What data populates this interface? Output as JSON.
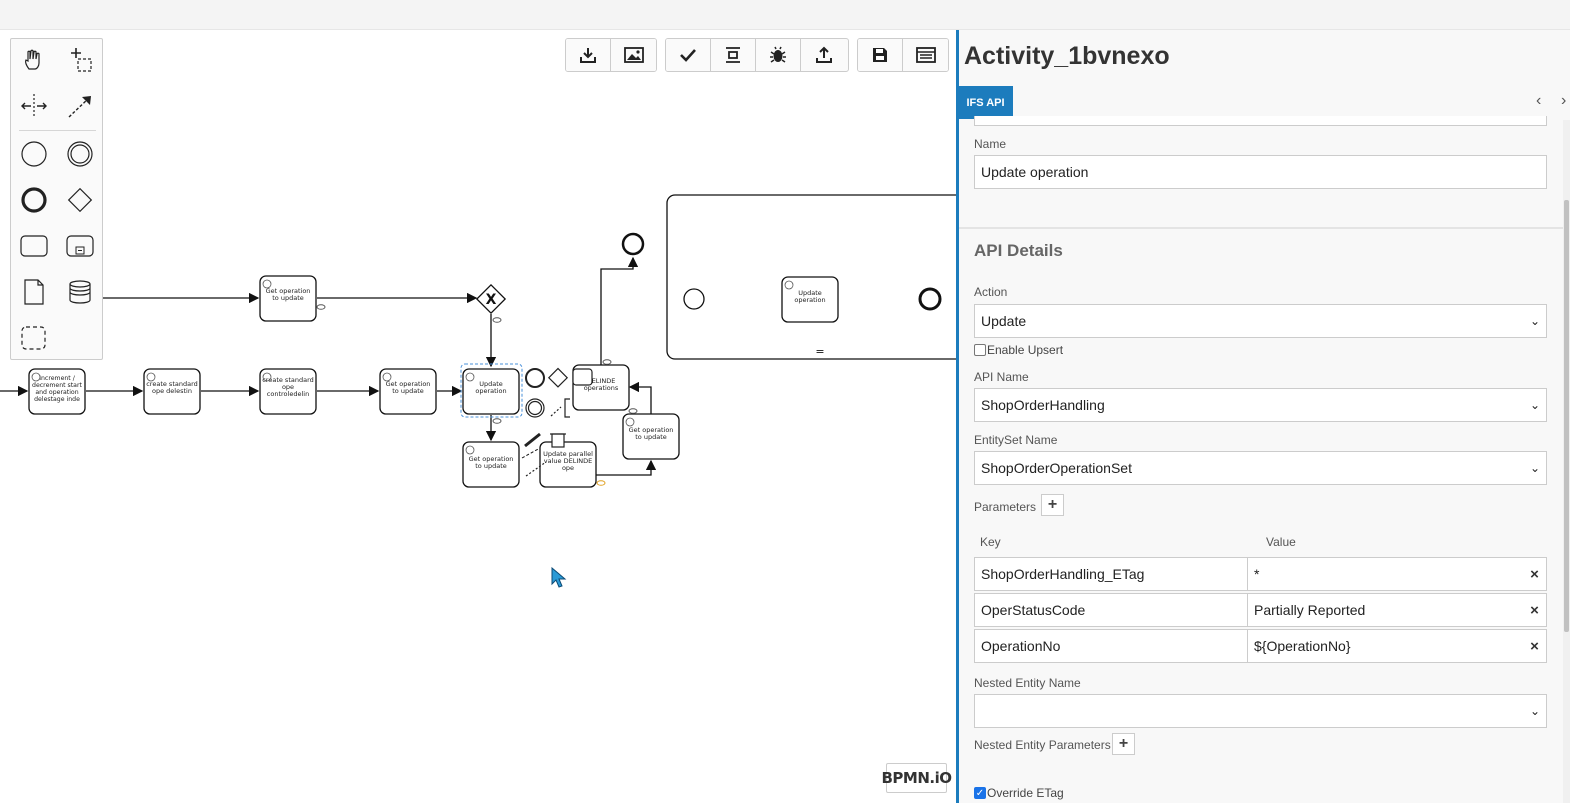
{
  "toolbar": {
    "groups": [
      [
        "download-icon",
        "image-icon"
      ],
      [
        "check-icon",
        "distribute-icon",
        "bug-icon",
        "upload-icon"
      ],
      [
        "save-icon",
        "panel-icon"
      ]
    ]
  },
  "palette": {
    "tools": [
      "hand-tool-icon",
      "lasso-tool-icon",
      "space-tool-icon",
      "connect-tool-icon",
      "start-event-icon",
      "intermediate-event-icon",
      "end-event-icon",
      "gateway-icon",
      "task-icon",
      "subprocess-icon",
      "data-object-icon",
      "data-store-icon",
      "group-icon"
    ]
  },
  "diagram": {
    "tasks": {
      "t_top": "Get operation to update",
      "t1": "Increment / decrement start and operation delestage inde",
      "t2": "create standard ope delestin",
      "t3": "create standard ope controledelin",
      "t4": "Get operation to update",
      "t5": "Update operation",
      "t6": "Get operation to update",
      "t7": "Update parallel value DELINDE ope",
      "t8": "DELINDE operations",
      "t9": "Get operation to update",
      "sub": "Update operation"
    },
    "gateway_marker": "X",
    "collapsed_marker": "="
  },
  "logo": "BPMN.iO",
  "panel": {
    "title": "Activity_1bvnexo",
    "tab": "IFS API",
    "name_label": "Name",
    "name_value": "Update operation",
    "section_title": "API Details",
    "action_label": "Action",
    "action_value": "Update",
    "enable_upsert_label": "Enable Upsert",
    "enable_upsert_checked": false,
    "api_name_label": "API Name",
    "api_name_value": "ShopOrderHandling",
    "entityset_label": "EntitySet Name",
    "entityset_value": "ShopOrderOperationSet",
    "parameters_label": "Parameters",
    "key_header": "Key",
    "value_header": "Value",
    "parameters": [
      {
        "key": "ShopOrderHandling_ETag",
        "value": "*"
      },
      {
        "key": "OperStatusCode",
        "value": "Partially Reported"
      },
      {
        "key": "OperationNo",
        "value": "${OperationNo}"
      }
    ],
    "nested_entity_label": "Nested Entity Name",
    "nested_entity_value": "",
    "nested_params_label": "Nested Entity Parameters",
    "override_etag_label": "Override ETag",
    "override_etag_checked": true
  },
  "colors": {
    "accent": "#1c7cbd",
    "selection": "#4a90d9",
    "checkbox": "#1a73e8"
  }
}
